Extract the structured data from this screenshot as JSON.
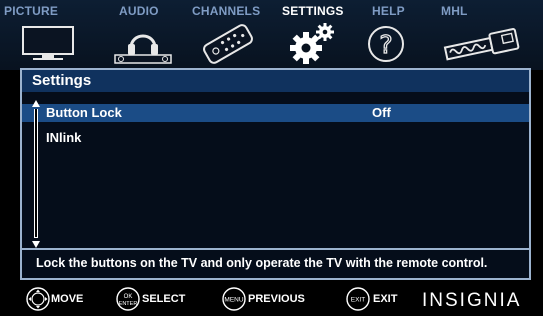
{
  "tabs": [
    {
      "label": "PICTURE",
      "icon": "tv-icon"
    },
    {
      "label": "AUDIO",
      "icon": "headphones-icon"
    },
    {
      "label": "CHANNELS",
      "icon": "remote-icon"
    },
    {
      "label": "SETTINGS",
      "icon": "gears-icon"
    },
    {
      "label": "HELP",
      "icon": "help-icon"
    },
    {
      "label": "MHL",
      "icon": "mhl-cable-icon"
    }
  ],
  "active_tab": "SETTINGS",
  "panel": {
    "title": "Settings",
    "items": [
      {
        "label": "Button Lock",
        "value": "Off",
        "selected": true
      },
      {
        "label": "INlink",
        "value": "",
        "selected": false
      }
    ],
    "description": "Lock the buttons on the TV and only operate the TV with the remote control."
  },
  "footer": {
    "move": {
      "key": "",
      "label": "MOVE"
    },
    "select": {
      "key_top": "OK",
      "key_bottom": "ENTER",
      "label": "SELECT"
    },
    "previous": {
      "key": "MENU",
      "label": "PREVIOUS"
    },
    "exit": {
      "key": "EXIT",
      "label": "EXIT"
    },
    "brand": "INSIGNIA"
  },
  "colors": {
    "accent": "#1b4c86",
    "header_bg": "#10325e",
    "tab_inactive": "#7f9cc4",
    "tab_active": "#ffffff"
  }
}
